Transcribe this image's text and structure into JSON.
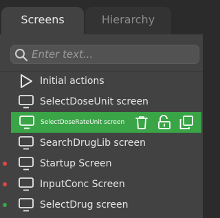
{
  "tabs": [
    {
      "label": "Screens",
      "active": true
    },
    {
      "label": "Hierarchy",
      "active": false
    }
  ],
  "search": {
    "placeholder": "Enter text...",
    "value": ""
  },
  "items": [
    {
      "label": "Initial actions",
      "icon": "play-icon",
      "status": null
    },
    {
      "label": "SelectDoseUnit screen",
      "icon": "monitor-icon",
      "status": null
    },
    {
      "label": "SelectDoseRateUnit screen",
      "icon": "monitor-icon",
      "status": null,
      "selected": true,
      "actions": [
        "trash-icon",
        "unlock-icon",
        "copy-icon"
      ]
    },
    {
      "label": "SearchDrugLib screen",
      "icon": "monitor-icon",
      "status": null
    },
    {
      "label": "Startup Screen",
      "icon": "monitor-icon",
      "status": "red"
    },
    {
      "label": "InputConc Screen",
      "icon": "monitor-icon",
      "status": "red"
    },
    {
      "label": "SelectDrug screen",
      "icon": "monitor-icon",
      "status": "green"
    }
  ],
  "colors": {
    "accent": "#3aa547",
    "status_red": "#e04646",
    "status_green": "#3aa547"
  }
}
